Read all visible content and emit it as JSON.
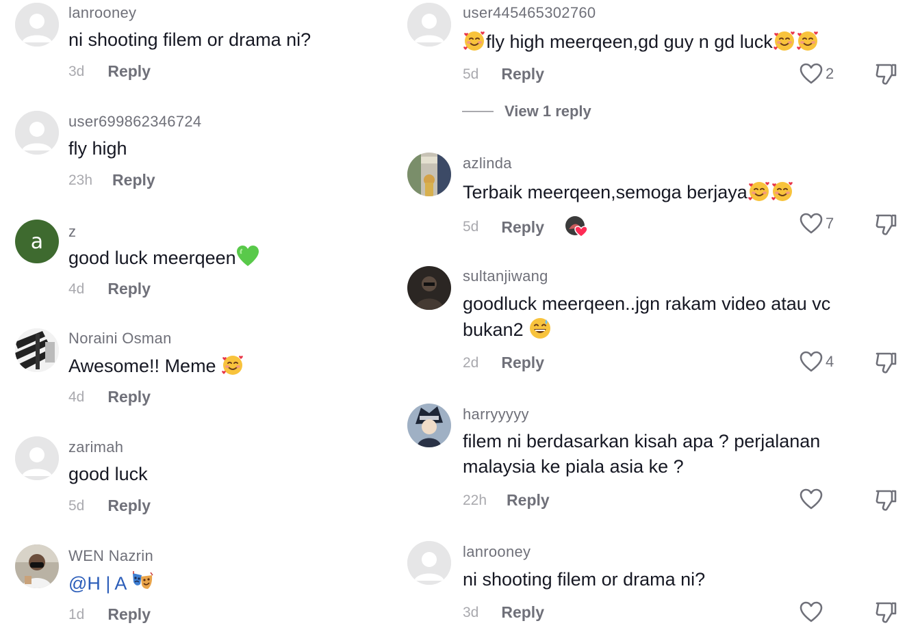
{
  "left_comments": [
    {
      "username": "lanrooney",
      "text": "ni shooting filem or drama ni?",
      "time": "3d",
      "reply": "Reply",
      "avatar": "default-avatar"
    },
    {
      "username": "user699862346724",
      "text": "fly high",
      "time": "23h",
      "reply": "Reply",
      "avatar": "default-avatar"
    },
    {
      "username": "z",
      "text": "good luck meerqeen",
      "time": "4d",
      "reply": "Reply",
      "avatar": "letter-avatar",
      "avatar_letter": "a",
      "avatar_color": "#3e6a2f",
      "emoji": "green-heart"
    },
    {
      "username": "Noraini Osman",
      "text": "Awesome!! Meme ",
      "time": "4d",
      "reply": "Reply",
      "avatar": "photo-avatar",
      "emoji": "smiling-face-with-hearts"
    },
    {
      "username": "zarimah",
      "text": "good luck",
      "time": "5d",
      "reply": "Reply",
      "avatar": "default-avatar"
    },
    {
      "username": "WEN Nazrin",
      "text": "@H | A ",
      "time": "1d",
      "reply": "Reply",
      "avatar": "photo-avatar",
      "emoji": "performing-arts"
    }
  ],
  "right_comments": [
    {
      "username": "user445465302760",
      "text": "fly high meerqeen,gd guy n gd luck",
      "time": "5d",
      "reply": "Reply",
      "likes": "2",
      "view_replies": "View 1 reply",
      "emoji": "smiling-face-with-hearts"
    },
    {
      "username": "azlinda",
      "text": "Terbaik meerqeen,semoga berjaya",
      "time": "5d",
      "reply": "Reply",
      "likes": "7",
      "emoji": "smiling-face-with-hearts",
      "liked_by_creator": true
    },
    {
      "username": "sultanjiwang",
      "text_line1": "goodluck meerqeen..jgn rakam video atau vc",
      "text_line2": "bukan2 ",
      "time": "2d",
      "reply": "Reply",
      "likes": "4",
      "emoji": "grinning-face-with-sweat"
    },
    {
      "username": "harryyyyy",
      "text_line1": "filem ni berdasarkan kisah apa ? perjalanan",
      "text_line2": "malaysia ke piala asia ke ?",
      "time": "22h",
      "reply": "Reply",
      "likes": ""
    },
    {
      "username": "lanrooney",
      "text": "ni shooting filem or drama ni?",
      "time": "3d",
      "reply": "Reply",
      "likes": ""
    }
  ],
  "colors": {
    "username": "#6f7079",
    "timestamp": "#a9a9ae",
    "text": "#161823",
    "mention": "#2b5db9",
    "default_avatar_bg": "#e6e6e7"
  },
  "icons": [
    "heart-outline-icon",
    "dislike-icon",
    "default-avatar-icon"
  ]
}
